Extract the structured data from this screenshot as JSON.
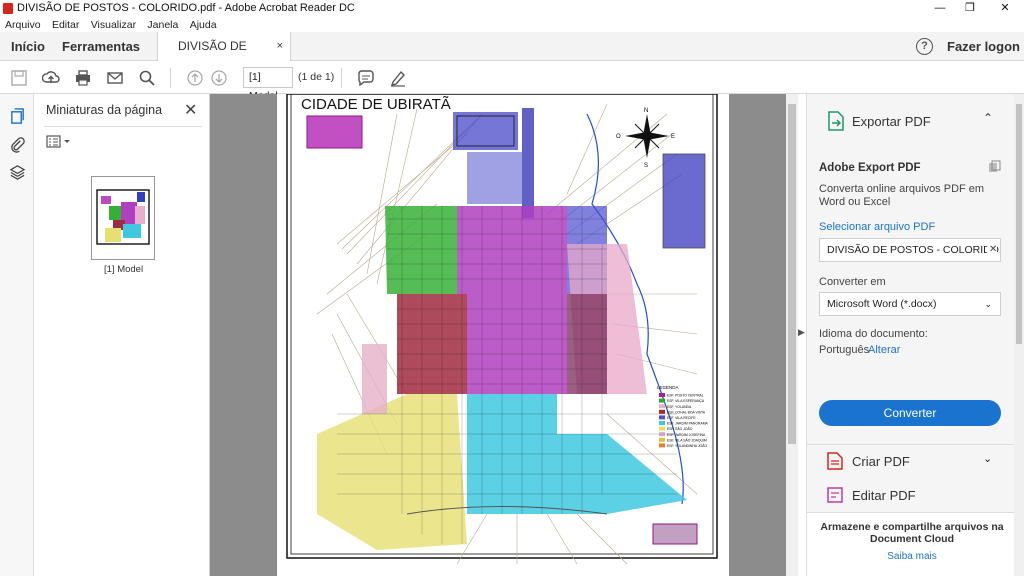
{
  "window": {
    "title": "DIVISÃO DE POSTOS - COLORIDO.pdf - Adobe Acrobat Reader DC",
    "minimize": "—",
    "restore": "❐",
    "close": "✕"
  },
  "menu": [
    "Arquivo",
    "Editar",
    "Visualizar",
    "Janela",
    "Ajuda"
  ],
  "tabs": {
    "home": "Início",
    "tools": "Ferramentas",
    "document": "DIVISÃO DE POST...",
    "close": "×",
    "help": "?",
    "login": "Fazer logon"
  },
  "toolbar": {
    "page_input": "[1] Model",
    "page_count": "(1 de 1)"
  },
  "thumbnails": {
    "title": "Miniaturas da página",
    "close": "✕",
    "page_label": "[1] Model"
  },
  "document": {
    "map_title": "CIDADE DE UBIRATÃ",
    "compass": {
      "n": "N",
      "s": "S",
      "e": "E",
      "w": "O"
    },
    "legend_title": "LEGENDA",
    "legend": [
      {
        "label": "ESF. POSTO CENTRAL",
        "color": "#a020a0"
      },
      {
        "label": "ESF. VILA ESPERANÇA",
        "color": "#2fa82f"
      },
      {
        "label": "ESF. YOLANDA",
        "color": "#e0b5c8"
      },
      {
        "label": "ESF. COHAL BOA VISTA",
        "color": "#a52a2a"
      },
      {
        "label": "ESF. VILA RECIFE",
        "color": "#5050d0"
      },
      {
        "label": "ESF. JARDIM PANORAMA",
        "color": "#40c8e0"
      },
      {
        "label": "ESF. SÃO JOÃO",
        "color": "#e8e060"
      },
      {
        "label": "ESF. JARDIM JOSEFINA",
        "color": "#d0a0d0"
      },
      {
        "label": "ESF. VILA SÃO JOAQUIM",
        "color": "#e0c040"
      },
      {
        "label": "ESF. YOLANDINHA JOÃO",
        "color": "#f08030"
      }
    ]
  },
  "right_panel": {
    "export_label": "Exportar PDF",
    "export_chev": "⌃",
    "adobe_export_title": "Adobe Export PDF",
    "adobe_export_desc_1": "Converta online arquivos PDF em",
    "adobe_export_desc_2": "Word ou Excel",
    "select_file_link": "Selecionar arquivo PDF",
    "selected_file": "DIVISÃO DE POSTOS - COLORIDO.pdf",
    "clear_file": "✕",
    "convert_to_label": "Converter em",
    "convert_to_value": "Microsoft Word (*.docx)",
    "language_label": "Idioma do documento:",
    "language_value": "Português",
    "language_change": "Alterar",
    "convert_button": "Converter",
    "create_pdf": "Criar PDF",
    "edit_pdf": "Editar PDF",
    "footer_text_1": "Armazene e compartilhe arquivos na",
    "footer_text_2": "Document Cloud",
    "footer_link": "Saiba mais"
  },
  "colors": {
    "accent": "#1b73d0",
    "link": "#1b73d0",
    "pdf_red": "#d8261d"
  }
}
